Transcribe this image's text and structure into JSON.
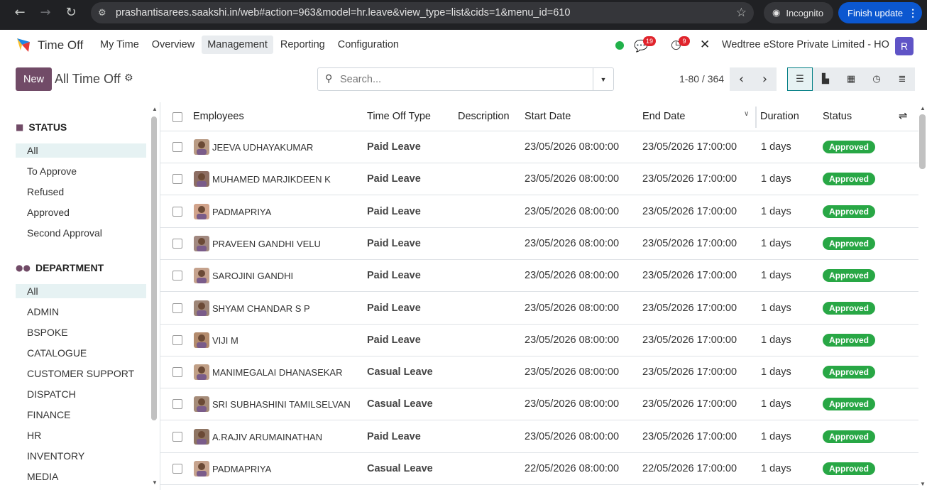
{
  "browser": {
    "url": "prashantisarees.saakshi.in/web#action=963&model=hr.leave&view_type=list&cids=1&menu_id=610",
    "incognito_label": "Incognito",
    "finish_update_label": "Finish update"
  },
  "topnav": {
    "app_name": "Time Off",
    "menu": [
      "My Time",
      "Overview",
      "Management",
      "Reporting",
      "Configuration"
    ],
    "active_menu": "Management",
    "messages_count": "19",
    "activities_count": "9",
    "company": "Wedtree eStore Private Limited - HO",
    "avatar_letter": "R",
    "colors": {
      "brand": "#714b67",
      "accent": "#017e84",
      "approved": "#28a745",
      "badge": "#e0242c",
      "online": "#21b14a"
    }
  },
  "control": {
    "new_label": "New",
    "title": "All Time Off",
    "search_placeholder": "Search...",
    "pager": "1-80 / 364",
    "views": [
      "list-view-icon",
      "kanban-view-icon",
      "calendar-view-icon",
      "activity-view-icon",
      "gantt-view-icon"
    ]
  },
  "sidebar": {
    "status_title": "STATUS",
    "status_items": [
      "All",
      "To Approve",
      "Refused",
      "Approved",
      "Second Approval"
    ],
    "department_title": "DEPARTMENT",
    "department_items": [
      "All",
      "ADMIN",
      "BSPOKE",
      "CATALOGUE",
      "CUSTOMER SUPPORT",
      "DISPATCH",
      "FINANCE",
      "HR",
      "INVENTORY",
      "MEDIA"
    ]
  },
  "table": {
    "columns": [
      "Employees",
      "Time Off Type",
      "Description",
      "Start Date",
      "End Date",
      "Duration",
      "Status"
    ],
    "rows": [
      {
        "employee": "JEEVA UDHAYAKUMAR",
        "type": "Paid Leave",
        "description": "",
        "start": "23/05/2026 08:00:00",
        "end": "23/05/2026 17:00:00",
        "duration": "1 days",
        "status": "Approved"
      },
      {
        "employee": "MUHAMED MARJIKDEEN K",
        "type": "Paid Leave",
        "description": "",
        "start": "23/05/2026 08:00:00",
        "end": "23/05/2026 17:00:00",
        "duration": "1 days",
        "status": "Approved"
      },
      {
        "employee": "PADMAPRIYA",
        "type": "Paid Leave",
        "description": "",
        "start": "23/05/2026 08:00:00",
        "end": "23/05/2026 17:00:00",
        "duration": "1 days",
        "status": "Approved"
      },
      {
        "employee": "PRAVEEN GANDHI VELU",
        "type": "Paid Leave",
        "description": "",
        "start": "23/05/2026 08:00:00",
        "end": "23/05/2026 17:00:00",
        "duration": "1 days",
        "status": "Approved"
      },
      {
        "employee": "SAROJINI GANDHI",
        "type": "Paid Leave",
        "description": "",
        "start": "23/05/2026 08:00:00",
        "end": "23/05/2026 17:00:00",
        "duration": "1 days",
        "status": "Approved"
      },
      {
        "employee": "SHYAM CHANDAR S P",
        "type": "Paid Leave",
        "description": "",
        "start": "23/05/2026 08:00:00",
        "end": "23/05/2026 17:00:00",
        "duration": "1 days",
        "status": "Approved"
      },
      {
        "employee": "VIJI M",
        "type": "Paid Leave",
        "description": "",
        "start": "23/05/2026 08:00:00",
        "end": "23/05/2026 17:00:00",
        "duration": "1 days",
        "status": "Approved"
      },
      {
        "employee": "MANIMEGALAI DHANASEKAR",
        "type": "Casual Leave",
        "description": "",
        "start": "23/05/2026 08:00:00",
        "end": "23/05/2026 17:00:00",
        "duration": "1 days",
        "status": "Approved"
      },
      {
        "employee": "SRI SUBHASHINI TAMILSELVAN",
        "type": "Casual Leave",
        "description": "",
        "start": "23/05/2026 08:00:00",
        "end": "23/05/2026 17:00:00",
        "duration": "1 days",
        "status": "Approved"
      },
      {
        "employee": "A.RAJIV ARUMAINATHAN",
        "type": "Paid Leave",
        "description": "",
        "start": "23/05/2026 08:00:00",
        "end": "23/05/2026 17:00:00",
        "duration": "1 days",
        "status": "Approved"
      },
      {
        "employee": "PADMAPRIYA",
        "type": "Casual Leave",
        "description": "",
        "start": "22/05/2026 08:00:00",
        "end": "22/05/2026 17:00:00",
        "duration": "1 days",
        "status": "Approved"
      }
    ]
  }
}
